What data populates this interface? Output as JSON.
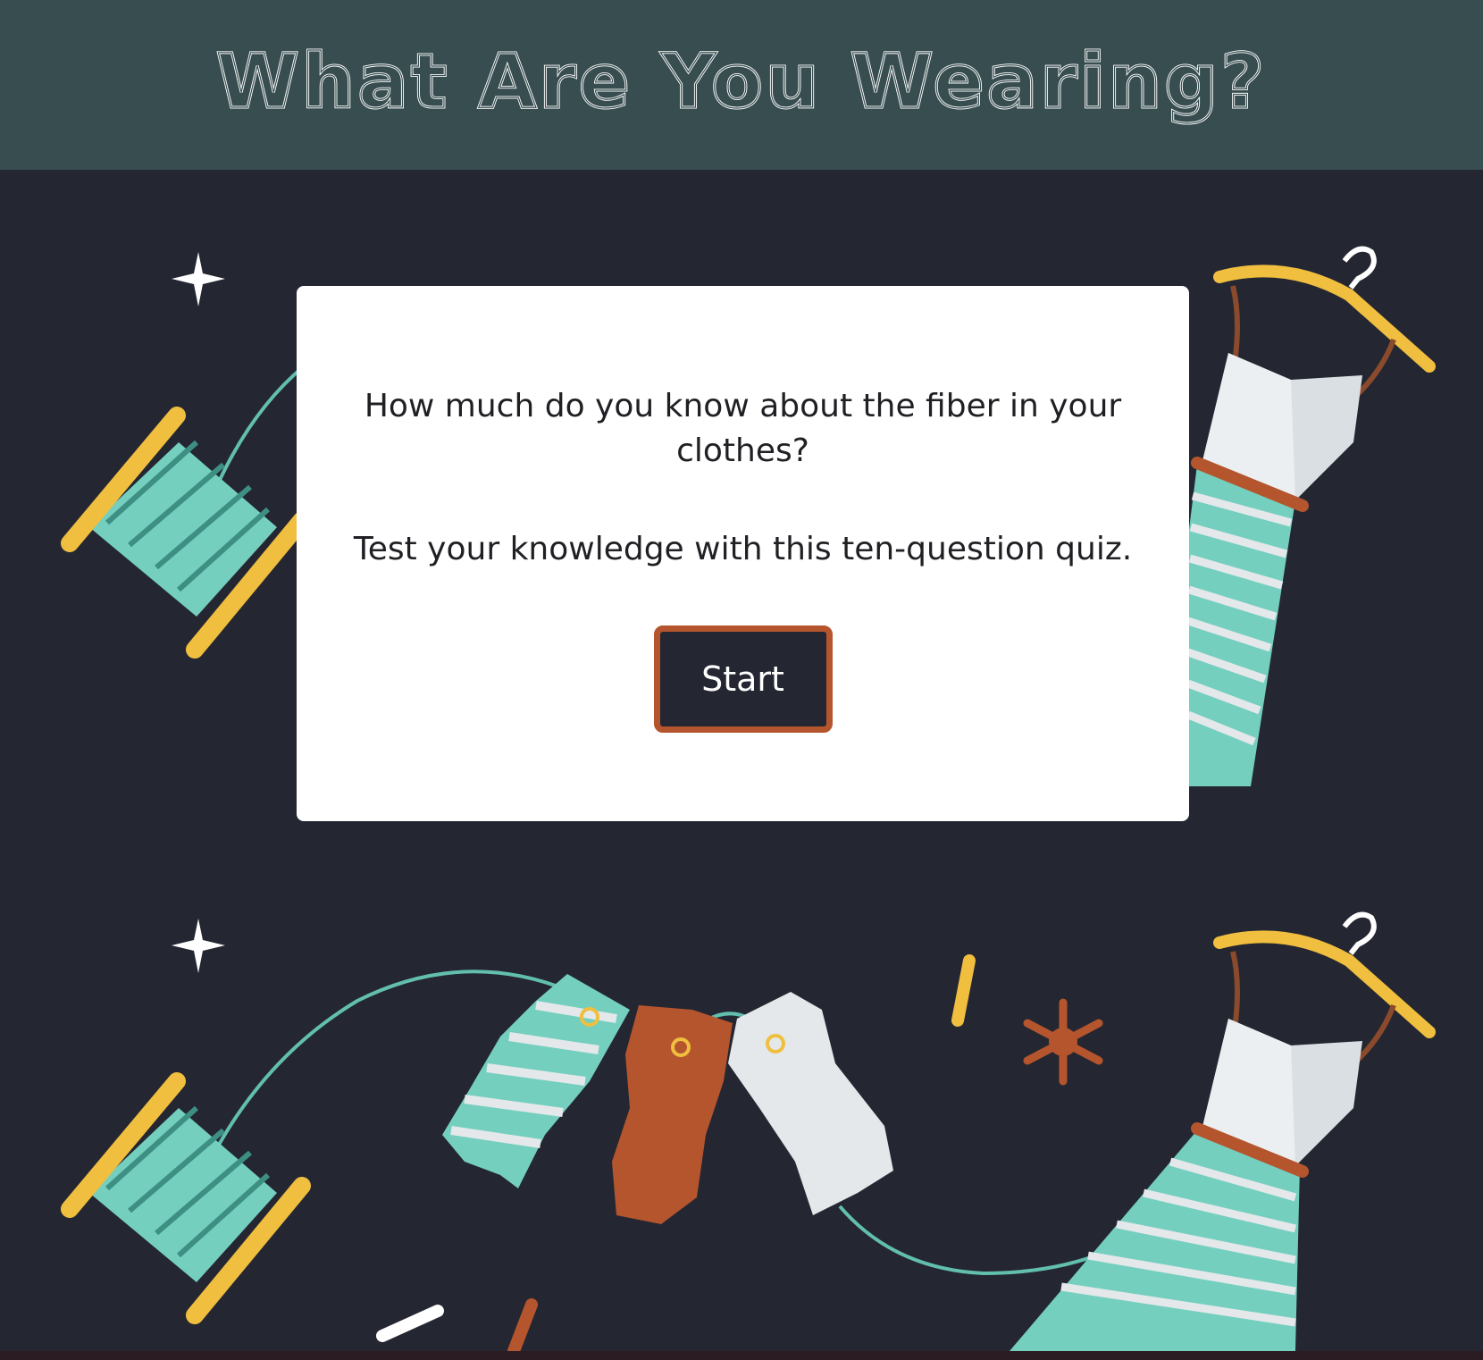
{
  "header": {
    "title": "What Are You Wearing?"
  },
  "intro": {
    "question": "How much do you know about the fiber in your clothes?",
    "description": "Test your knowledge with this ten-question quiz.",
    "start_label": "Start"
  },
  "colors": {
    "header_bg": "#374d50",
    "page_bg": "#242632",
    "card_bg": "#ffffff",
    "button_bg": "#242632",
    "button_border": "#b5552d",
    "teal": "#74cfbf",
    "yellow": "#f0bf3f",
    "rust": "#b5552d",
    "light_gray": "#e4e8ea"
  }
}
